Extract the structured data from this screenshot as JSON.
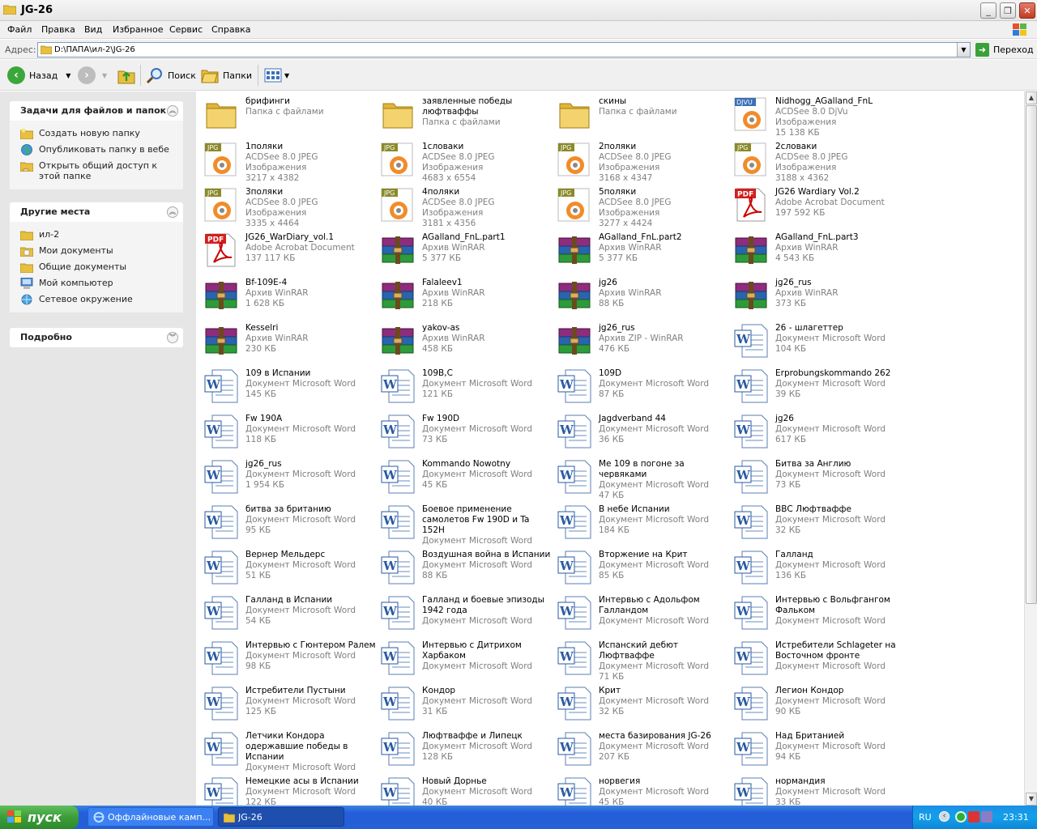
{
  "window": {
    "title": "JG-26"
  },
  "menu": [
    "Файл",
    "Правка",
    "Вид",
    "Избранное",
    "Сервис",
    "Справка"
  ],
  "address": {
    "label": "Адрес:",
    "path": "D:\\ПАПА\\ил-2\\JG-26",
    "go_label": "Переход"
  },
  "toolbar": {
    "back_label": "Назад",
    "search_label": "Поиск",
    "folders_label": "Папки"
  },
  "tasks_panel": {
    "title": "Задачи для файлов и папок",
    "items": [
      "Создать новую папку",
      "Опубликовать папку в вебе",
      "Открыть общий доступ к этой папке"
    ]
  },
  "places_panel": {
    "title": "Другие места",
    "items": [
      "ил-2",
      "Мои документы",
      "Общие документы",
      "Мой компьютер",
      "Сетевое окружение"
    ]
  },
  "details_panel": {
    "title": "Подробно"
  },
  "files": [
    {
      "name": "брифинги",
      "lines": [
        "Папка с файлами"
      ],
      "icon": "folder"
    },
    {
      "name": "заявленные победы люфтваффы",
      "lines": [
        "Папка с файлами"
      ],
      "icon": "folder"
    },
    {
      "name": "скины",
      "lines": [
        "Папка с файлами"
      ],
      "icon": "folder"
    },
    {
      "name": "Nidhogg_AGalland_FnL",
      "lines": [
        "ACDSee 8.0 DjVu Изображения",
        "15 138 КБ"
      ],
      "icon": "djvu"
    },
    {
      "name": "1поляки",
      "lines": [
        "ACDSee 8.0 JPEG Изображения",
        "3217 x 4382"
      ],
      "icon": "jpg"
    },
    {
      "name": "1словаки",
      "lines": [
        "ACDSee 8.0 JPEG Изображения",
        "4683 x 6554"
      ],
      "icon": "jpg"
    },
    {
      "name": "2поляки",
      "lines": [
        "ACDSee 8.0 JPEG Изображения",
        "3168 x 4347"
      ],
      "icon": "jpg"
    },
    {
      "name": "2словаки",
      "lines": [
        "ACDSee 8.0 JPEG Изображения",
        "3188 x 4362"
      ],
      "icon": "jpg"
    },
    {
      "name": "3поляки",
      "lines": [
        "ACDSee 8.0 JPEG Изображения",
        "3335 x 4464"
      ],
      "icon": "jpg"
    },
    {
      "name": "4поляки",
      "lines": [
        "ACDSee 8.0 JPEG Изображения",
        "3181 x 4356"
      ],
      "icon": "jpg"
    },
    {
      "name": "5поляки",
      "lines": [
        "ACDSee 8.0 JPEG Изображения",
        "3277 x 4424"
      ],
      "icon": "jpg"
    },
    {
      "name": "JG26 Wardiary Vol.2",
      "lines": [
        "Adobe Acrobat Document",
        "197 592 КБ"
      ],
      "icon": "pdf"
    },
    {
      "name": "JG26_WarDiary_vol.1",
      "lines": [
        "Adobe Acrobat Document",
        "137 117 КБ"
      ],
      "icon": "pdf"
    },
    {
      "name": "AGalland_FnL.part1",
      "lines": [
        "Архив WinRAR",
        "5 377 КБ"
      ],
      "icon": "rar"
    },
    {
      "name": "AGalland_FnL.part2",
      "lines": [
        "Архив WinRAR",
        "5 377 КБ"
      ],
      "icon": "rar"
    },
    {
      "name": "AGalland_FnL.part3",
      "lines": [
        "Архив WinRAR",
        "4 543 КБ"
      ],
      "icon": "rar"
    },
    {
      "name": "Bf-109E-4",
      "lines": [
        "Архив WinRAR",
        "1 628 КБ"
      ],
      "icon": "rar"
    },
    {
      "name": "Falaleev1",
      "lines": [
        "Архив WinRAR",
        "218 КБ"
      ],
      "icon": "rar"
    },
    {
      "name": "jg26",
      "lines": [
        "Архив WinRAR",
        "88 КБ"
      ],
      "icon": "rar"
    },
    {
      "name": "jg26_rus",
      "lines": [
        "Архив WinRAR",
        "373 КБ"
      ],
      "icon": "rar"
    },
    {
      "name": "Kesselri",
      "lines": [
        "Архив WinRAR",
        "230 КБ"
      ],
      "icon": "rar"
    },
    {
      "name": "yakov-as",
      "lines": [
        "Архив WinRAR",
        "458 КБ"
      ],
      "icon": "rar"
    },
    {
      "name": "jg26_rus",
      "lines": [
        "Архив ZIP - WinRAR",
        "476 КБ"
      ],
      "icon": "rar"
    },
    {
      "name": "26 - шлагеттер",
      "lines": [
        "Документ Microsoft Word",
        "104 КБ"
      ],
      "icon": "word"
    },
    {
      "name": "109 в Испании",
      "lines": [
        "Документ Microsoft Word",
        "145 КБ"
      ],
      "icon": "word"
    },
    {
      "name": "109В,С",
      "lines": [
        "Документ Microsoft Word",
        "121 КБ"
      ],
      "icon": "word"
    },
    {
      "name": "109D",
      "lines": [
        "Документ Microsoft Word",
        "87 КБ"
      ],
      "icon": "word"
    },
    {
      "name": "Erprobungskommando 262",
      "lines": [
        "Документ Microsoft Word",
        "39 КБ"
      ],
      "icon": "word"
    },
    {
      "name": "Fw 190A",
      "lines": [
        "Документ Microsoft Word",
        "118 КБ"
      ],
      "icon": "word"
    },
    {
      "name": "Fw 190D",
      "lines": [
        "Документ Microsoft Word",
        "73 КБ"
      ],
      "icon": "word"
    },
    {
      "name": "Jagdverband 44",
      "lines": [
        "Документ Microsoft Word",
        "36 КБ"
      ],
      "icon": "word"
    },
    {
      "name": "jg26",
      "lines": [
        "Документ Microsoft Word",
        "617 КБ"
      ],
      "icon": "word"
    },
    {
      "name": "jg26_rus",
      "lines": [
        "Документ Microsoft Word",
        "1 954 КБ"
      ],
      "icon": "word"
    },
    {
      "name": "Kommando Nowotny",
      "lines": [
        "Документ Microsoft Word",
        "45 КБ"
      ],
      "icon": "word"
    },
    {
      "name": "Me 109 в погоне за червяками",
      "lines": [
        "Документ Microsoft Word",
        "47 КБ"
      ],
      "icon": "word"
    },
    {
      "name": "Битва за Англию",
      "lines": [
        "Документ Microsoft Word",
        "73 КБ"
      ],
      "icon": "word"
    },
    {
      "name": "битва за британию",
      "lines": [
        "Документ Microsoft Word",
        "95 КБ"
      ],
      "icon": "word"
    },
    {
      "name": "Боевое применение самолетов Fw 190D и Ta 152H",
      "lines": [
        "Документ Microsoft Word"
      ],
      "icon": "word"
    },
    {
      "name": "В небе  Испании",
      "lines": [
        "Документ Microsoft Word",
        "184 КБ"
      ],
      "icon": "word"
    },
    {
      "name": "ВВС Люфтваффе",
      "lines": [
        "Документ Microsoft Word",
        "32 КБ"
      ],
      "icon": "word"
    },
    {
      "name": "Вернер Мельдерс",
      "lines": [
        "Документ Microsoft Word",
        "51 КБ"
      ],
      "icon": "word"
    },
    {
      "name": "Воздушная война в Испании",
      "lines": [
        "Документ Microsoft Word",
        "88 КБ"
      ],
      "icon": "word"
    },
    {
      "name": "Вторжение на Крит",
      "lines": [
        "Документ Microsoft Word",
        "85 КБ"
      ],
      "icon": "word"
    },
    {
      "name": "Галланд",
      "lines": [
        "Документ Microsoft Word",
        "136 КБ"
      ],
      "icon": "word"
    },
    {
      "name": "Галланд в Испании",
      "lines": [
        "Документ Microsoft Word",
        "54 КБ"
      ],
      "icon": "word"
    },
    {
      "name": "Галланд и боевые эпизоды 1942 года",
      "lines": [
        "Документ Microsoft Word"
      ],
      "icon": "word"
    },
    {
      "name": "Интервью с Адольфом Галландом",
      "lines": [
        "Документ Microsoft Word"
      ],
      "icon": "word"
    },
    {
      "name": "Интервью с Вольфгангом Фальком",
      "lines": [
        "Документ Microsoft Word"
      ],
      "icon": "word"
    },
    {
      "name": "Интервью с Гюнтером Ралем",
      "lines": [
        "Документ Microsoft Word",
        "98 КБ"
      ],
      "icon": "word"
    },
    {
      "name": "Интервью с Дитрихом Харбаком",
      "lines": [
        "Документ Microsoft Word"
      ],
      "icon": "word"
    },
    {
      "name": "Испанский дебют Люфтваффе",
      "lines": [
        "Документ Microsoft Word",
        "71 КБ"
      ],
      "icon": "word"
    },
    {
      "name": "Истребители Schlageter на Восточном фронте",
      "lines": [
        "Документ Microsoft Word"
      ],
      "icon": "word"
    },
    {
      "name": "Истребители Пустыни",
      "lines": [
        "Документ Microsoft Word",
        "125 КБ"
      ],
      "icon": "word"
    },
    {
      "name": "Кондор",
      "lines": [
        "Документ Microsoft Word",
        "31 КБ"
      ],
      "icon": "word"
    },
    {
      "name": "Крит",
      "lines": [
        "Документ Microsoft Word",
        "32 КБ"
      ],
      "icon": "word"
    },
    {
      "name": "Легион Кондор",
      "lines": [
        "Документ Microsoft Word",
        "90 КБ"
      ],
      "icon": "word"
    },
    {
      "name": "Летчики Кондора одержавшие победы в Испании",
      "lines": [
        "Документ Microsoft Word"
      ],
      "icon": "word"
    },
    {
      "name": "Люфтваффе и Липецк",
      "lines": [
        "Документ Microsoft Word",
        "128 КБ"
      ],
      "icon": "word"
    },
    {
      "name": "места базирования JG-26",
      "lines": [
        "Документ Microsoft Word",
        "207 КБ"
      ],
      "icon": "word"
    },
    {
      "name": "Над Британией",
      "lines": [
        "Документ Microsoft Word",
        "94 КБ"
      ],
      "icon": "word"
    },
    {
      "name": "Немецкие асы в Испании",
      "lines": [
        "Документ Microsoft Word",
        "122 КБ"
      ],
      "icon": "word"
    },
    {
      "name": "Новый Дорнье",
      "lines": [
        "Документ Microsoft Word",
        "40 КБ"
      ],
      "icon": "word"
    },
    {
      "name": "норвегия",
      "lines": [
        "Документ Microsoft Word",
        "45 КБ"
      ],
      "icon": "word"
    },
    {
      "name": "нормандия",
      "lines": [
        "Документ Microsoft Word",
        "33 КБ"
      ],
      "icon": "word"
    }
  ],
  "taskbar": {
    "start_label": "пуск",
    "buttons": [
      "Оффлайновые камп...",
      "JG-26"
    ],
    "lang": "RU",
    "clock": "23:31"
  }
}
